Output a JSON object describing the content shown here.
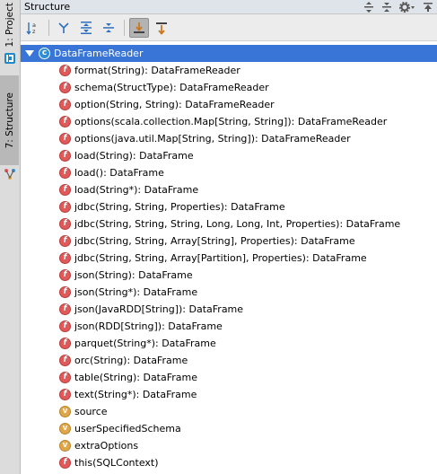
{
  "left_strip": {
    "project_tab": "1: Project",
    "structure_tab": "7: Structure"
  },
  "header": {
    "title": "Structure"
  },
  "toolbar": {
    "buttons": [
      "sort-alphabetically",
      "sort-by-visibility",
      "expand-all",
      "collapse-all",
      "autoscroll-to-source",
      "autoscroll-from-source"
    ]
  },
  "tree": {
    "root": {
      "label": "DataFrameReader",
      "icon": "class-icon"
    },
    "items": [
      {
        "kind": "f",
        "label": "format(String): DataFrameReader"
      },
      {
        "kind": "f",
        "label": "schema(StructType): DataFrameReader"
      },
      {
        "kind": "f",
        "label": "option(String, String): DataFrameReader"
      },
      {
        "kind": "f",
        "label": "options(scala.collection.Map[String, String]): DataFrameReader"
      },
      {
        "kind": "f",
        "label": "options(java.util.Map[String, String]): DataFrameReader"
      },
      {
        "kind": "f",
        "label": "load(String): DataFrame"
      },
      {
        "kind": "f",
        "label": "load(): DataFrame"
      },
      {
        "kind": "f",
        "label": "load(String*): DataFrame"
      },
      {
        "kind": "f",
        "label": "jdbc(String, String, Properties): DataFrame"
      },
      {
        "kind": "f",
        "label": "jdbc(String, String, String, Long, Long, Int, Properties): DataFrame"
      },
      {
        "kind": "f",
        "label": "jdbc(String, String, Array[String], Properties): DataFrame"
      },
      {
        "kind": "f",
        "label": "jdbc(String, String, Array[Partition], Properties): DataFrame"
      },
      {
        "kind": "f",
        "label": "json(String): DataFrame"
      },
      {
        "kind": "f",
        "label": "json(String*): DataFrame"
      },
      {
        "kind": "f",
        "label": "json(JavaRDD[String]): DataFrame"
      },
      {
        "kind": "f",
        "label": "json(RDD[String]): DataFrame"
      },
      {
        "kind": "f",
        "label": "parquet(String*): DataFrame"
      },
      {
        "kind": "f",
        "label": "orc(String): DataFrame"
      },
      {
        "kind": "f",
        "label": "table(String): DataFrame"
      },
      {
        "kind": "f",
        "label": "text(String*): DataFrame"
      },
      {
        "kind": "v",
        "label": "source"
      },
      {
        "kind": "v",
        "label": "userSpecifiedSchema"
      },
      {
        "kind": "v",
        "label": "extraOptions"
      },
      {
        "kind": "f",
        "label": "this(SQLContext)"
      }
    ]
  },
  "colors": {
    "selection": "#3875d7",
    "method_icon": "#e05a5a",
    "field_icon": "#e0a64a",
    "header_bg": "#dfe4ea"
  }
}
